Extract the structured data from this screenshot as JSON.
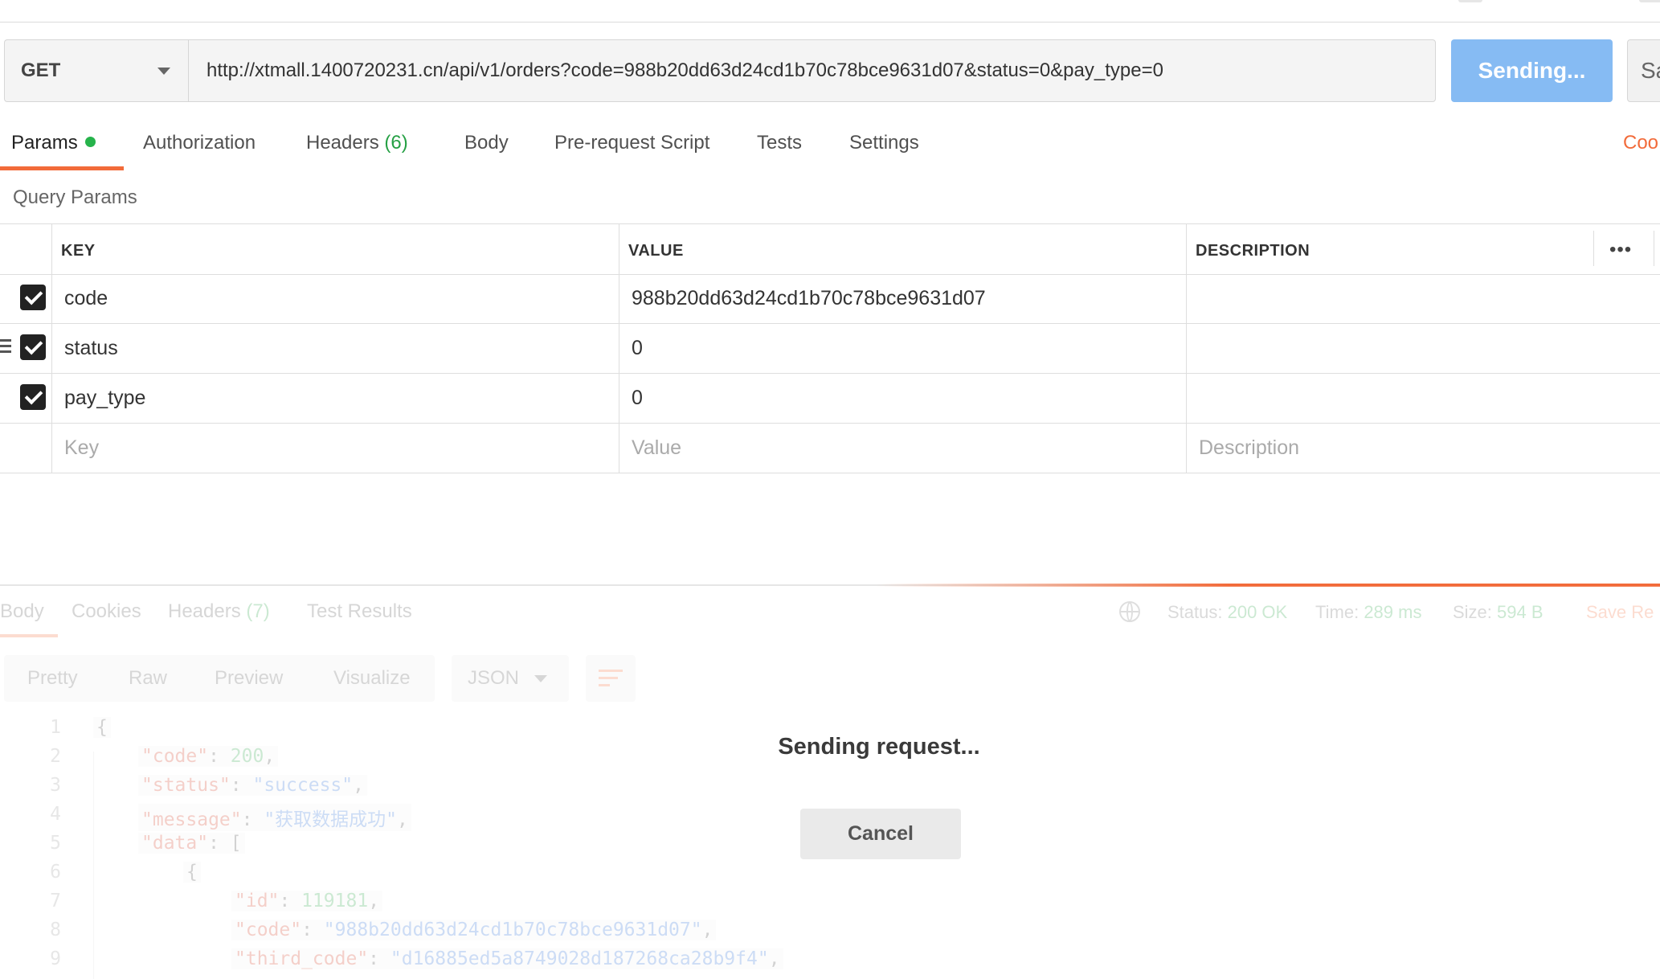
{
  "request": {
    "method": "GET",
    "url": "http://xtmall.1400720231.cn/api/v1/orders?code=988b20dd63d24cd1b70c78bce9631d07&status=0&pay_type=0",
    "send_label": "Sending...",
    "save_label": "Sa"
  },
  "request_tabs": {
    "params": "Params",
    "authorization": "Authorization",
    "headers": "Headers",
    "headers_count": "(6)",
    "body": "Body",
    "prerequest": "Pre-request Script",
    "tests": "Tests",
    "settings": "Settings",
    "cookies": "Coo"
  },
  "query_params": {
    "title": "Query Params",
    "columns": {
      "key": "KEY",
      "value": "VALUE",
      "description": "DESCRIPTION"
    },
    "more": "•••",
    "rows": [
      {
        "key": "code",
        "value": "988b20dd63d24cd1b70c78bce9631d07",
        "checked": true
      },
      {
        "key": "status",
        "value": "0",
        "checked": true
      },
      {
        "key": "pay_type",
        "value": "0",
        "checked": true
      }
    ],
    "placeholders": {
      "key": "Key",
      "value": "Value",
      "description": "Description"
    }
  },
  "response": {
    "tabs": {
      "body": "Body",
      "cookies": "Cookies",
      "headers": "Headers",
      "headers_count": "(7)",
      "test_results": "Test Results"
    },
    "status_label": "Status:",
    "status_value": "200 OK",
    "time_label": "Time:",
    "time_value": "289 ms",
    "size_label": "Size:",
    "size_value": "594 B",
    "save_response": "Save Re",
    "modes": {
      "pretty": "Pretty",
      "raw": "Raw",
      "preview": "Preview",
      "visualize": "Visualize"
    },
    "format": "JSON",
    "lines": [
      {
        "num": "1",
        "text": "{"
      },
      {
        "num": "2",
        "key": "\"code\"",
        "sep": ": ",
        "val": "200",
        "kind": "n",
        "tail": ","
      },
      {
        "num": "3",
        "key": "\"status\"",
        "sep": ": ",
        "val": "\"success\"",
        "kind": "s",
        "tail": ","
      },
      {
        "num": "4",
        "key": "\"message\"",
        "sep": ": ",
        "val": "\"获取数据成功\"",
        "kind": "s",
        "tail": ","
      },
      {
        "num": "5",
        "key": "\"data\"",
        "sep": ": ",
        "val": "[",
        "kind": "p",
        "tail": ""
      },
      {
        "num": "6",
        "text": "{"
      },
      {
        "num": "7",
        "key": "\"id\"",
        "sep": ": ",
        "val": "119181",
        "kind": "n",
        "tail": ","
      },
      {
        "num": "8",
        "key": "\"code\"",
        "sep": ": ",
        "val": "\"988b20dd63d24cd1b70c78bce9631d07\"",
        "kind": "s",
        "tail": ","
      },
      {
        "num": "9",
        "key": "\"third_code\"",
        "sep": ": ",
        "val": "\"d16885ed5a8749028d187268ca28b9f4\"",
        "kind": "s",
        "tail": ","
      }
    ]
  },
  "overlay": {
    "message": "Sending request...",
    "cancel": "Cancel"
  }
}
